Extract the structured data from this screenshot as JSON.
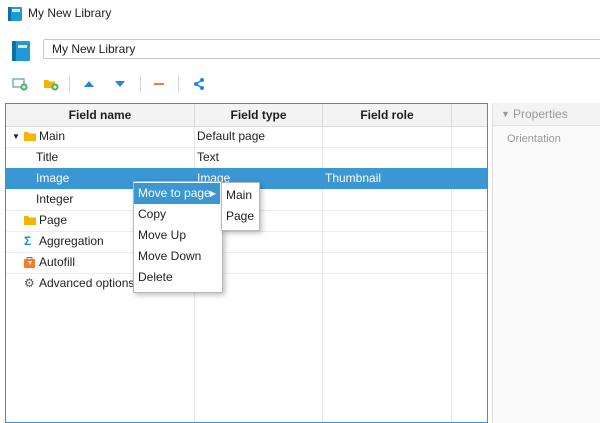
{
  "window": {
    "title": "My New Library",
    "icon": "library-icon"
  },
  "library": {
    "name": "My New Library"
  },
  "toolbar": [
    {
      "name": "add-field-icon",
      "icon": "add-field"
    },
    {
      "name": "add-folder-icon",
      "icon": "add-folder"
    },
    {
      "name": "move-up-icon",
      "icon": "triangle-up"
    },
    {
      "name": "move-down-icon",
      "icon": "triangle-down"
    },
    {
      "name": "remove-icon",
      "icon": "minus"
    },
    {
      "name": "share-icon",
      "icon": "share"
    }
  ],
  "table": {
    "headers": {
      "field_name": "Field name",
      "field_type": "Field type",
      "field_role": "Field role"
    },
    "rows": [
      {
        "name": "Main",
        "type": "Default page",
        "role": "",
        "icon": "folder-icon",
        "expanded": true
      },
      {
        "name": "Title",
        "type": "Text",
        "role": ""
      },
      {
        "name": "Image",
        "type": "Image",
        "role": "Thumbnail",
        "selected": true
      },
      {
        "name": "Integer",
        "type": "",
        "role": ""
      },
      {
        "name": "Page",
        "type": "",
        "role": "",
        "icon": "folder-icon"
      },
      {
        "name": "Aggregation",
        "type": "",
        "role": "",
        "icon": "sigma-icon"
      },
      {
        "name": "Autofill",
        "type": "",
        "role": "",
        "icon": "autofill-icon"
      },
      {
        "name": "Advanced options",
        "type": "",
        "role": "",
        "icon": "gear-icon"
      }
    ]
  },
  "properties": {
    "header": "Properties",
    "orientation_label": "Orientation"
  },
  "context_menu": {
    "items": [
      "Move to page",
      "Copy",
      "Move Up",
      "Move Down",
      "Delete"
    ],
    "submenu": [
      "Main",
      "Page"
    ]
  },
  "colors": {
    "accent": "#3a97d4",
    "folder": "#f4b400",
    "arrow_blue": "#1e88e5",
    "minus_orange": "#f57c2e"
  }
}
